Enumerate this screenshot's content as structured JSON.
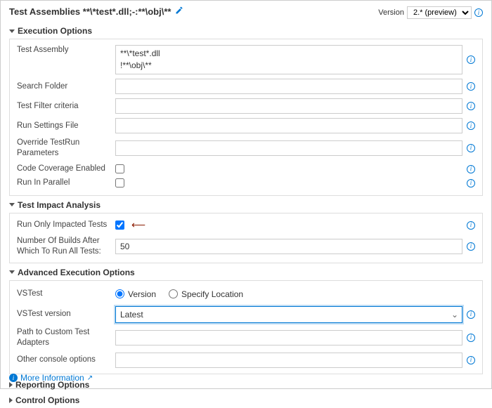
{
  "header": {
    "title": "Test Assemblies **\\*test*.dll;-:**\\obj\\**",
    "version_label": "Version",
    "version_value": "2.* (preview)"
  },
  "sections": {
    "execution": {
      "title": "Execution Options",
      "fields": {
        "test_assembly": {
          "label": "Test Assembly",
          "value": "**\\*test*.dll\n!**\\obj\\**"
        },
        "search_folder": {
          "label": "Search Folder",
          "value": ""
        },
        "test_filter": {
          "label": "Test Filter criteria",
          "value": ""
        },
        "run_settings": {
          "label": "Run Settings File",
          "value": ""
        },
        "override_params": {
          "label": "Override TestRun Parameters",
          "value": ""
        },
        "code_coverage": {
          "label": "Code Coverage Enabled",
          "checked": false
        },
        "run_parallel": {
          "label": "Run In Parallel",
          "checked": false
        }
      }
    },
    "impact": {
      "title": "Test Impact Analysis",
      "fields": {
        "run_impacted": {
          "label": "Run Only Impacted Tests",
          "checked": true
        },
        "builds_after": {
          "label": "Number Of Builds After Which To Run All Tests:",
          "value": "50"
        }
      }
    },
    "advanced": {
      "title": "Advanced Execution Options",
      "fields": {
        "vstest": {
          "label": "VSTest",
          "option_version": "Version",
          "option_location": "Specify Location",
          "selected": "version"
        },
        "vstest_version": {
          "label": "VSTest version",
          "value": "Latest"
        },
        "custom_adapters": {
          "label": "Path to Custom Test Adapters",
          "value": ""
        },
        "other_console": {
          "label": "Other console options",
          "value": ""
        }
      }
    },
    "reporting": {
      "title": "Reporting Options"
    },
    "control": {
      "title": "Control Options"
    }
  },
  "footer": {
    "more_info": "More Information"
  }
}
